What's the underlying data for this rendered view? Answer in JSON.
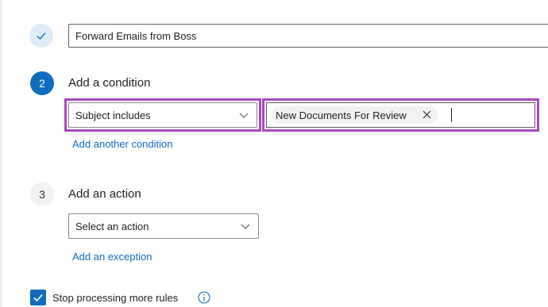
{
  "steps": {
    "name": {
      "status_icon": "check-icon",
      "value": "Forward Emails from Boss"
    },
    "condition": {
      "number": "2",
      "title": "Add a condition",
      "dropdown_value": "Subject includes",
      "chip_label": "New Documents For Review",
      "add_link": "Add another condition"
    },
    "action": {
      "number": "3",
      "title": "Add an action",
      "dropdown_value": "Select an action",
      "exception_link": "Add an exception"
    }
  },
  "options": {
    "stop_processing_label": "Stop processing more rules",
    "stop_processing_checked": true
  },
  "colors": {
    "accent": "#0f6cbd",
    "highlight": "#a94bbf"
  }
}
